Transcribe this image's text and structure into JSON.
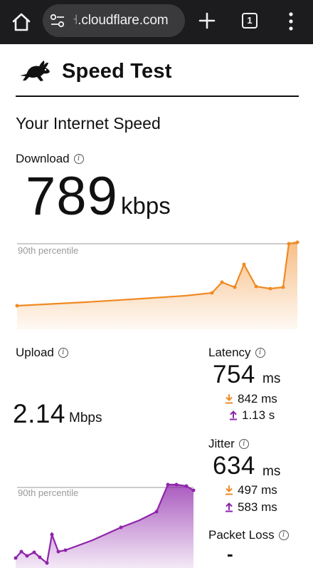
{
  "browser": {
    "url_faded": "˧",
    "url_domain": ".cloudflare.com",
    "tab_count": "1",
    "icons": [
      "home-icon",
      "site-settings-icon",
      "new-tab-plus-icon",
      "tab-switcher-icon",
      "menu-kebab-icon"
    ]
  },
  "header": {
    "title": "Speed Test",
    "logo_icon": "rabbit-logo-icon"
  },
  "main": {
    "section_title": "Your Internet Speed",
    "download": {
      "label": "Download",
      "value": "789",
      "unit": "kbps",
      "chart_label": "90th percentile",
      "color": "#f08a24"
    },
    "upload": {
      "label": "Upload",
      "value": "2.14",
      "unit": "Mbps",
      "chart_label": "90th percentile",
      "color": "#8e24aa"
    },
    "latency": {
      "label": "Latency",
      "value": "754",
      "unit": "ms",
      "down_value": "842 ms",
      "up_value": "1.13 s"
    },
    "jitter": {
      "label": "Jitter",
      "value": "634",
      "unit": "ms",
      "down_value": "497 ms",
      "up_value": "583 ms"
    },
    "packet_loss": {
      "label": "Packet Loss",
      "value": "-"
    }
  }
}
